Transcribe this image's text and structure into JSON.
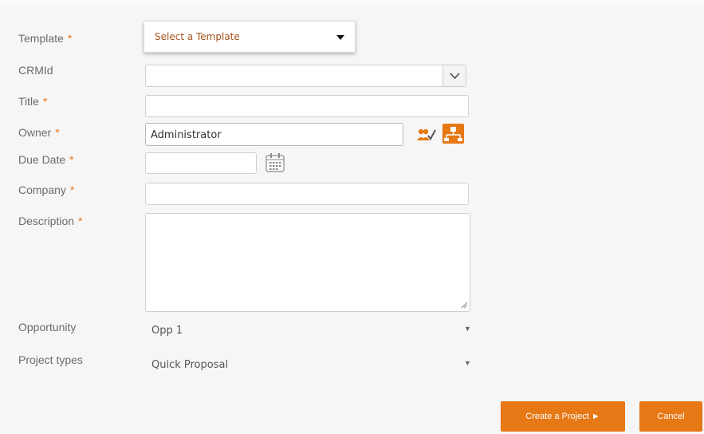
{
  "form": {
    "template": {
      "label": "Template",
      "placeholder": "Select a Template"
    },
    "crmid": {
      "label": "CRMId",
      "value": ""
    },
    "title": {
      "label": "Title",
      "value": ""
    },
    "owner": {
      "label": "Owner",
      "value": "Administrator"
    },
    "due_date": {
      "label": "Due Date",
      "value": ""
    },
    "company": {
      "label": "Company",
      "value": ""
    },
    "description": {
      "label": "Description",
      "value": ""
    },
    "opportunity": {
      "label": "Opportunity",
      "value": "Opp 1"
    },
    "project_types": {
      "label": "Project types",
      "value": "Quick Proposal"
    },
    "required_marker": "*"
  },
  "icons": {
    "owner_select": "user-check-icon",
    "owner_org": "org-chart-icon",
    "calendar": "calendar-icon",
    "dropdown": "chevron-down-icon"
  },
  "actions": {
    "create_label": "Create a Project ►",
    "cancel_label": "Cancel"
  },
  "colors": {
    "accent": "#e67815",
    "required": "#e8741a"
  }
}
